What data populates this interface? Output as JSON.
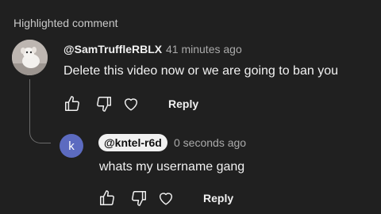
{
  "section": {
    "title": "Highlighted comment"
  },
  "comment": {
    "author": "@SamTruffleRBLX",
    "time": "41 minutes ago",
    "text": "Delete this video now or we are going to ban you",
    "actions": {
      "like_icon": "thumb-up-icon",
      "dislike_icon": "thumb-down-icon",
      "heart_icon": "heart-icon",
      "reply_label": "Reply"
    }
  },
  "reply": {
    "avatar_letter": "k",
    "avatar_color": "#5c6bc0",
    "author": "@kntel-r6d",
    "time": "0 seconds ago",
    "text": "whats my username gang",
    "actions": {
      "like_icon": "thumb-up-icon",
      "dislike_icon": "thumb-down-icon",
      "heart_icon": "heart-icon",
      "reply_label": "Reply"
    }
  },
  "colors": {
    "background": "#202020",
    "text": "#f1f1f1",
    "muted": "#aaaaaa"
  }
}
